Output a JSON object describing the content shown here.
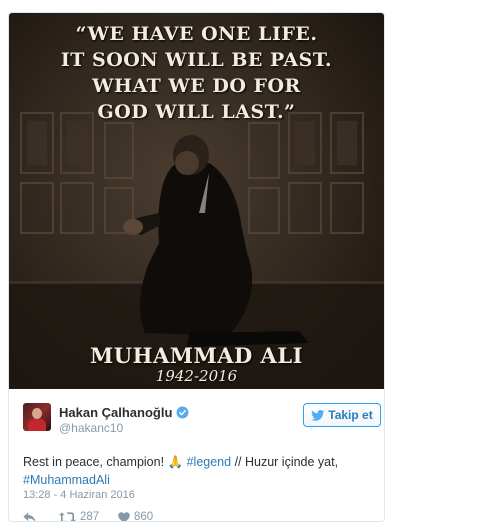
{
  "photo": {
    "quote_lines": [
      "“WE HAVE ONE LIFE.",
      "IT SOON WILL BE PAST.",
      "WHAT WE DO FOR",
      "GOD WILL LAST.”"
    ],
    "name": "MUHAMMAD ALI",
    "years": "1942-2016"
  },
  "tweet": {
    "user_name": "Hakan Çalhanoğlu",
    "handle": "@hakanc10",
    "follow_label": "Takip et",
    "text_part1": "Rest in peace, champion! ",
    "emoji": "🙏",
    "hashtag1": "#legend",
    "text_part2": " // Huzur içinde yat, ",
    "hashtag2": "#MuhammadAli",
    "timestamp": "13:28 - 4 Haziran 2016",
    "retweets": "287",
    "likes": "860"
  },
  "colors": {
    "link": "#2b7bb9",
    "verified": "#55acee",
    "muted": "#8899a6",
    "text": "#292f33"
  }
}
